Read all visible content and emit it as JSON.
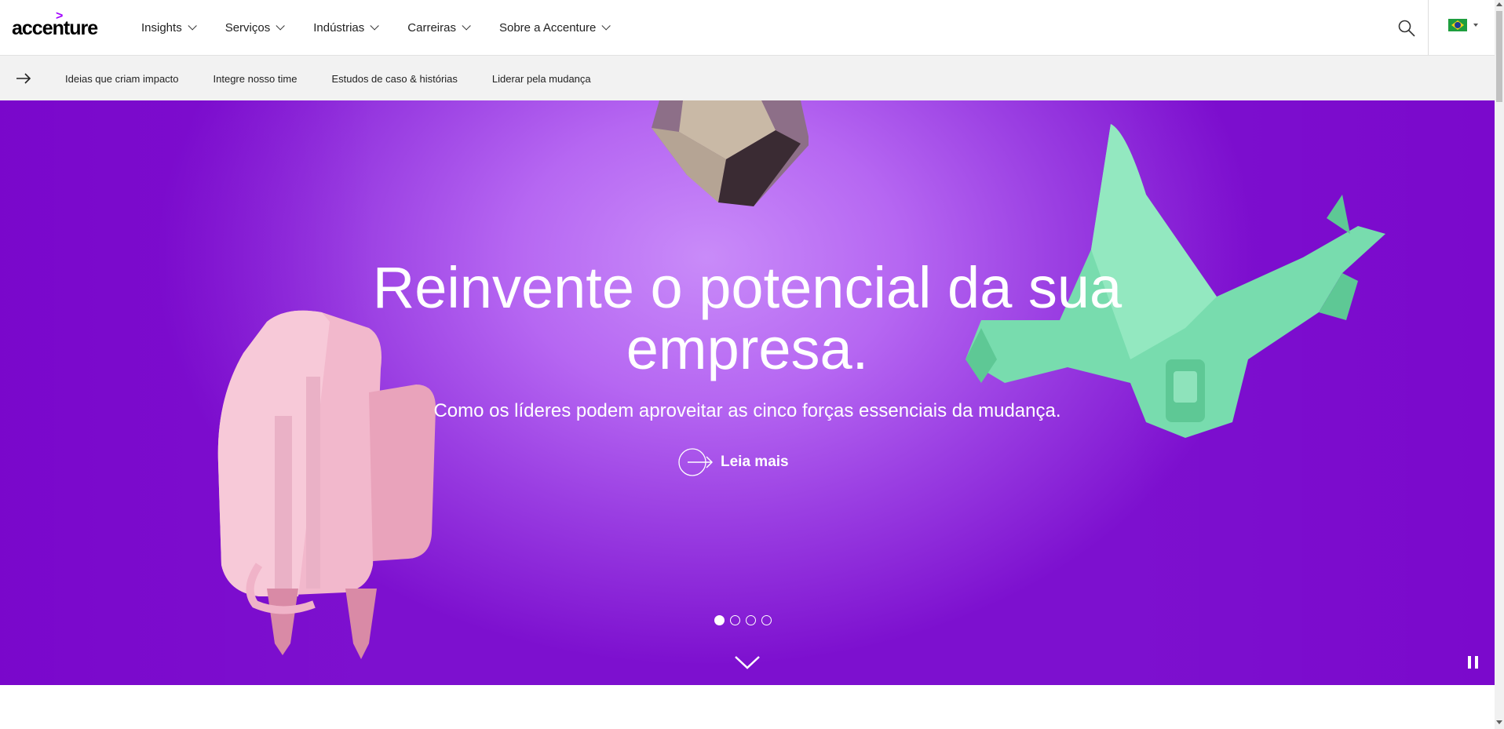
{
  "logo": {
    "text": "accenture",
    "mark": ">"
  },
  "nav": {
    "items": [
      {
        "label": "Insights"
      },
      {
        "label": "Serviços"
      },
      {
        "label": "Indústrias"
      },
      {
        "label": "Carreiras"
      },
      {
        "label": "Sobre a Accenture"
      }
    ],
    "search_icon": "search-icon",
    "country_flag": "brazil-flag-icon"
  },
  "subnav": {
    "arrow_icon": "arrow-right-icon",
    "items": [
      {
        "label": "Ideias que criam impacto"
      },
      {
        "label": "Integre nosso time"
      },
      {
        "label": "Estudos de caso & histórias"
      },
      {
        "label": "Liderar pela mudança"
      }
    ]
  },
  "hero": {
    "title": "Reinvente o potencial da sua empresa.",
    "subtitle": "Como os líderes podem aproveitar as cinco forças essenciais da mudança.",
    "cta_label": "Leia mais",
    "slides_total": 4,
    "slide_active": 1,
    "colors": {
      "brand": "#a100ff",
      "hero_bg": "#9a3ee2"
    }
  }
}
